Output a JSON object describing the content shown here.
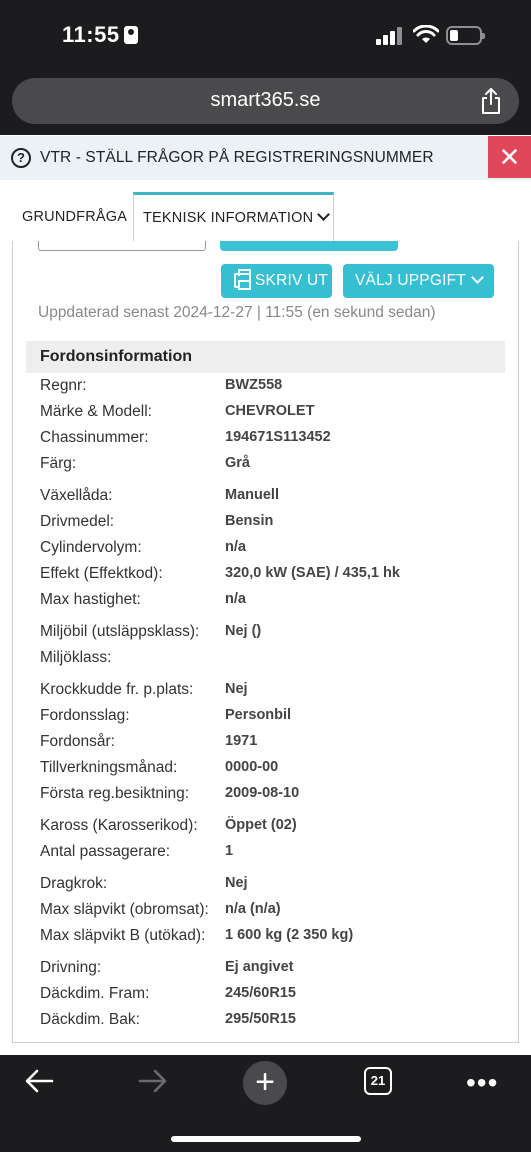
{
  "status_bar": {
    "time": "11:55"
  },
  "browser": {
    "url": "smart365.se",
    "tabs_count": "21"
  },
  "notice": {
    "text": "VTR - STÄLL FRÅGOR PÅ REGISTRERINGSNUMMER",
    "close": "✕"
  },
  "tabs": [
    {
      "label": "GRUNDFRÅGA"
    },
    {
      "label": "TEKNISK INFORMATION"
    }
  ],
  "actions": {
    "print_label": "SKRIV UT",
    "select_label": "VÄLJ UPPGIFT"
  },
  "updated_text": "Uppdaterad senast 2024-12-27 | 11:55 (en sekund sedan)",
  "section_title": "Fordonsinformation",
  "rows": [
    {
      "label": "Regnr:",
      "value": "BWZ558"
    },
    {
      "label": "Märke & Modell:",
      "value": "CHEVROLET"
    },
    {
      "label": "Chassinummer:",
      "value": "194671S113452"
    },
    {
      "label": "Färg:",
      "value": "Grå"
    },
    {
      "label": "Växellåda:",
      "value": "Manuell"
    },
    {
      "label": "Drivmedel:",
      "value": "Bensin"
    },
    {
      "label": "Cylindervolym:",
      "value": "n/a"
    },
    {
      "label": "Effekt (Effektkod):",
      "value": "320,0 kW (SAE) / 435,1 hk"
    },
    {
      "label": "Max hastighet:",
      "value": "n/a"
    },
    {
      "label": "Miljöbil (utsläppsklass):",
      "value": "Nej ()"
    },
    {
      "label": "Miljöklass:",
      "value": ""
    },
    {
      "label": "Krockkudde fr. p.plats:",
      "value": "Nej"
    },
    {
      "label": "Fordonsslag:",
      "value": "Personbil"
    },
    {
      "label": "Fordonsår:",
      "value": "1971"
    },
    {
      "label": "Tillverkningsmånad:",
      "value": "0000-00"
    },
    {
      "label": "Första reg.besiktning:",
      "value": "2009-08-10"
    },
    {
      "label": "Kaross (Karosserikod):",
      "value": "Öppet (02)"
    },
    {
      "label": "Antal passagerare:",
      "value": "1"
    },
    {
      "label": "Dragkrok:",
      "value": "Nej"
    },
    {
      "label": "Max släpvikt (obromsat):",
      "value": "n/a (n/a)"
    },
    {
      "label": "Max släpvikt B (utökad):",
      "value": "1 600 kg (2 350 kg)"
    },
    {
      "label": "Drivning:",
      "value": "Ej angivet"
    },
    {
      "label": "Däckdim. Fram:",
      "value": "245/60R15"
    },
    {
      "label": "Däckdim. Bak:",
      "value": "295/50R15"
    }
  ],
  "colors": {
    "accent": "#36bfd1",
    "close": "#e0475a",
    "notice_bg": "#eaf2f7",
    "chrome": "#1c1c1e"
  },
  "icons": [
    "help-icon",
    "close-icon",
    "chevron-down-icon",
    "printer-icon",
    "share-icon",
    "back-arrow-icon",
    "forward-arrow-icon",
    "plus-icon",
    "tabs-icon",
    "more-icon"
  ]
}
